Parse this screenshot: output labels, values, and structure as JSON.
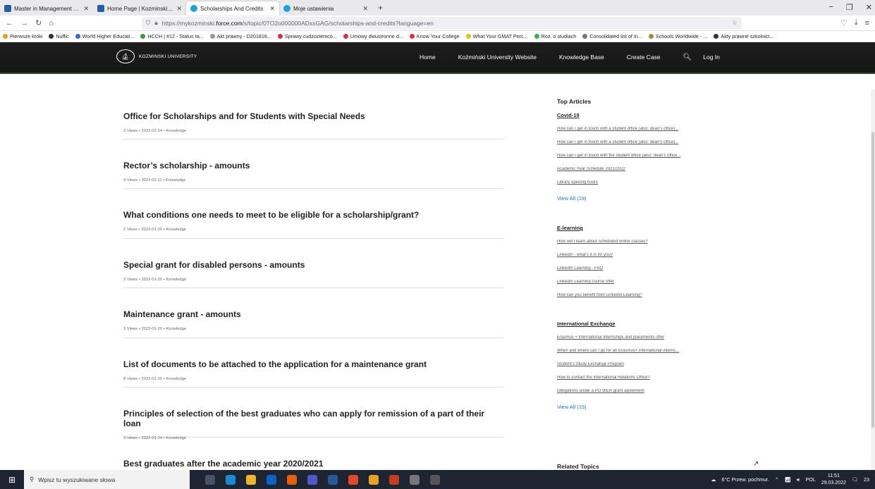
{
  "browser": {
    "tabs": [
      {
        "title": "Master in Management - Maste",
        "active": false
      },
      {
        "title": "Home Page | Kozminski Univer",
        "active": false
      },
      {
        "title": "Scholarships And Credits",
        "active": true
      },
      {
        "title": "Moje ustawienia",
        "active": false
      }
    ],
    "url_prefix": "https://mykozminski.",
    "url_domain": "force.com",
    "url_suffix": "/s/topic/0TO2o000000ADxxGAG/scholarships-and-credits?language=en",
    "bookmarks": [
      "Pierwsze kroki",
      "Nuffic",
      "World Higher Educati...",
      "HCCH | #12 - Status ta...",
      "Akt prawny - D201816...",
      "Sprawy cudzoziemcó...",
      "Umowy dwustronne d...",
      "Know Your College",
      "What Your GMAT Perc...",
      "Roz. o studiach",
      "Consolidated list of In...",
      "Schools Worldwide - ...",
      "Akty prawne szkolnict..."
    ]
  },
  "site": {
    "logo_text": "KOZMINSKI UNIVERSITY",
    "nav": {
      "home": "Home",
      "website": "Koźmiński University Website",
      "kb": "Knowledge Base",
      "case": "Create Case",
      "login": "Log In"
    }
  },
  "articles": [
    {
      "title": "Office for Scholarships and for Students with Special Needs",
      "meta": "3 Views • 2022-02-24 • Knowledge"
    },
    {
      "title": "Rector’s scholarship - amounts",
      "meta": "4 Views • 2022-02-11 • Knowledge"
    },
    {
      "title": "What conditions one needs to meet to be eligible for a scholarship/grant?",
      "meta": "2 Views • 2022-01-20 • Knowledge"
    },
    {
      "title": "Special grant for disabled persons - amounts",
      "meta": "2 Views • 2022-01-20 • Knowledge"
    },
    {
      "title": "Maintenance grant - amounts",
      "meta": "3 Views • 2022-01-20 • Knowledge"
    },
    {
      "title": "List of documents to be attached to the application for a maintenance grant",
      "meta": "8 Views • 2022-01-20 • Knowledge"
    },
    {
      "title": "Principles of selection of the best graduates who can apply for remission of a part of their loan",
      "meta": "3 Views • 2022-01-14 • Knowledge"
    },
    {
      "title": "Best graduates after the academic year 2020/2021",
      "meta": ""
    }
  ],
  "sidebar": {
    "heading": "Top Articles",
    "sections": [
      {
        "name": "Covid-19",
        "links": [
          "How can I get in touch with a student office (also: dean's office)...",
          "How can I get in touch with a student office (also: dean's office)...",
          "How can I get in touch with the student office (also: dean's office...",
          "Academic Year Schedule 2021/2022",
          "Library opening hours"
        ],
        "view_all": "View All (19)"
      },
      {
        "name": "E-learning",
        "links": [
          "How will I learn about scheduled online classes?",
          "LinkedIn - what's it in for you?",
          "LinkedIn Learning - FAQ",
          "LinkedIn Learning course offer",
          "How can you benefit from LinkedIn Learning?"
        ],
        "view_all": ""
      },
      {
        "name": "International Exchange",
        "links": [
          "Erasmus + International Internships and placements offer",
          "When and where can I go for an Erasmus+ international interns...",
          "Student's Study Exchange Program",
          "How to contact the International Relations Office?",
          "Obligations under a PO WER grant agreement"
        ],
        "view_all": "View All (15)"
      }
    ],
    "related": "Related Topics"
  },
  "taskbar": {
    "search_placeholder": "Wpisz tu wyszukiwane słowa",
    "weather": "6°C  Przew. pochmur.",
    "lang": "POL",
    "time": "11:51",
    "date": "29.03.2022",
    "notif": "23"
  }
}
